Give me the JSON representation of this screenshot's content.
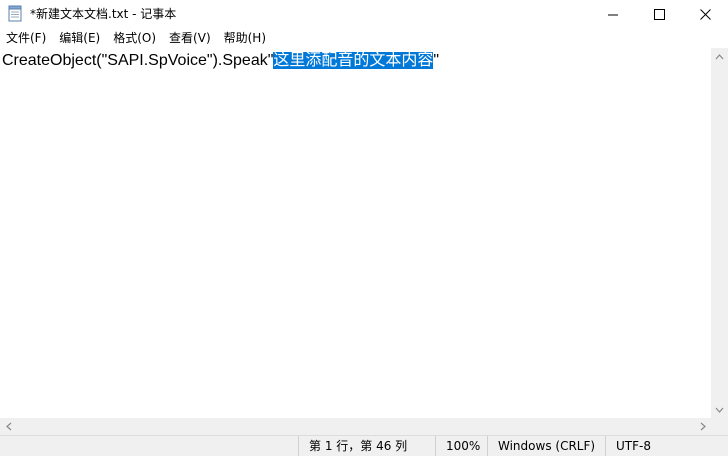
{
  "window": {
    "title": "*新建文本文档.txt - 记事本",
    "icon": "notepad-icon",
    "controls": [
      "minimize-icon",
      "maximize-icon",
      "close-icon"
    ]
  },
  "menu": {
    "items": [
      "文件(F)",
      "编辑(E)",
      "格式(O)",
      "查看(V)",
      "帮助(H)"
    ]
  },
  "editor": {
    "text_before": "CreateObject(\"SAPI.SpVoice\").Speak\"",
    "selected_text": "这里添配音的文本内容",
    "text_after": "\""
  },
  "status": {
    "position": "第 1 行，第 46 列",
    "zoom": "100%",
    "line_ending": "Windows (CRLF)",
    "encoding": "UTF-8"
  },
  "colors": {
    "selection": "#0078d7",
    "chrome": "#f0f0f0"
  }
}
